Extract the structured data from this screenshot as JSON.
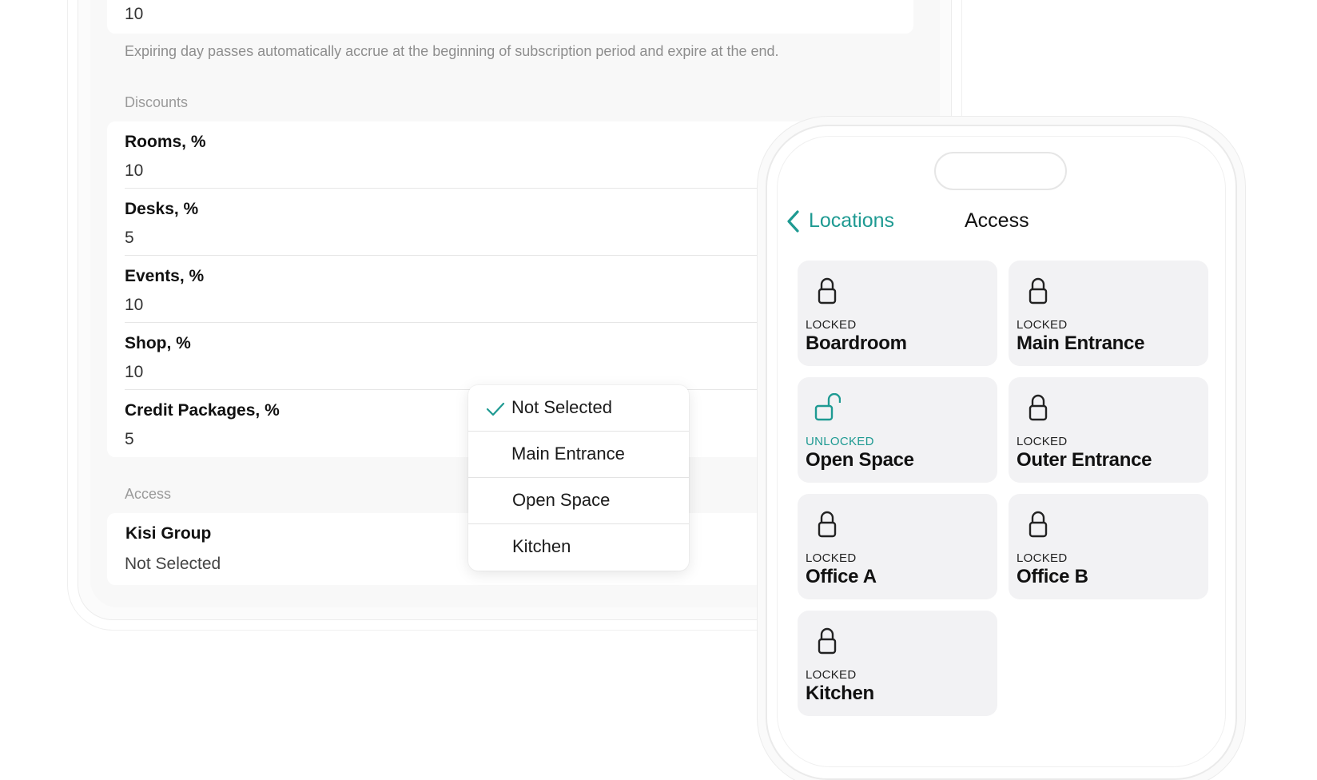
{
  "settings": {
    "day_passes_value": "10",
    "day_passes_hint": "Expiring day passes automatically accrue at the beginning of subscription period and expire at the end.",
    "discounts_title": "Discounts",
    "discounts": [
      {
        "label": "Rooms, %",
        "value": "10"
      },
      {
        "label": "Desks, %",
        "value": "5"
      },
      {
        "label": "Events, %",
        "value": "10"
      },
      {
        "label": "Shop, %",
        "value": "10"
      },
      {
        "label": "Credit Packages, %",
        "value": "5"
      }
    ],
    "access_title": "Access",
    "kisi_group_label": "Kisi Group",
    "kisi_group_value": "Not Selected"
  },
  "dropdown": {
    "options": [
      "Not Selected",
      "Main Entrance",
      "Open Space",
      "Kitchen"
    ],
    "selected": "Not Selected"
  },
  "phone": {
    "back_label": "Locations",
    "title": "Access",
    "doors": [
      {
        "status": "LOCKED",
        "name": "Boardroom",
        "locked": true
      },
      {
        "status": "LOCKED",
        "name": "Main Entrance",
        "locked": true
      },
      {
        "status": "UNLOCKED",
        "name": "Open Space",
        "locked": false
      },
      {
        "status": "LOCKED",
        "name": "Outer Entrance",
        "locked": true
      },
      {
        "status": "LOCKED",
        "name": "Office A",
        "locked": true
      },
      {
        "status": "LOCKED",
        "name": "Office B",
        "locked": true
      },
      {
        "status": "LOCKED",
        "name": "Kitchen",
        "locked": true
      }
    ]
  },
  "colors": {
    "accent": "#1e9a92",
    "tile_bg": "#f2f2f4",
    "page_bg": "#f8f8f8"
  },
  "icons": [
    "check-icon",
    "chevron-left-icon",
    "lock-icon",
    "unlock-icon"
  ]
}
